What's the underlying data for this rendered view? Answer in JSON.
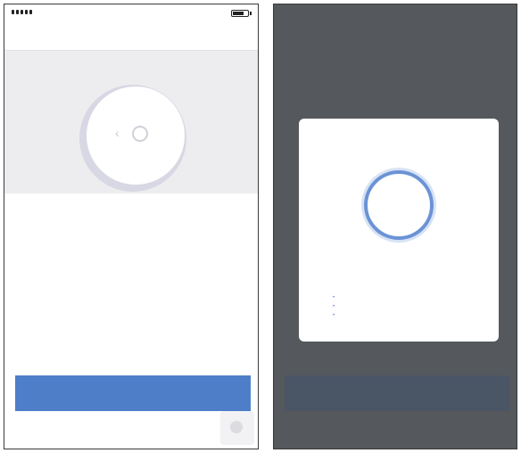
{
  "left": {
    "status": {
      "carrier": "",
      "time": ""
    },
    "nav": {
      "back": "",
      "title": "",
      "right": ""
    },
    "instruction": "",
    "help_link": "",
    "confirm_button": ""
  },
  "right": {
    "back": "",
    "modal": {
      "title": "",
      "progress": "",
      "note": "",
      "steps": [
        "",
        "",
        ""
      ]
    }
  },
  "colors": {
    "primary": "#4e7ec8",
    "link": "#4a78c4",
    "overlay": "#55585c",
    "ring": "#6b93d6"
  },
  "icons": [
    "signal-icon",
    "battery-icon",
    "device-illustration",
    "home-icon"
  ]
}
